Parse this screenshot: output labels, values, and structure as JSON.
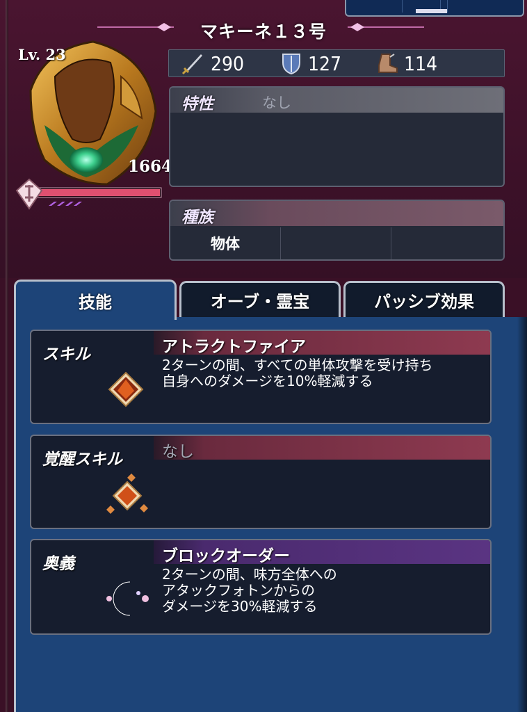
{
  "unit": {
    "name": "マキーネ１３号",
    "level": "Lv. 23",
    "power": "1664"
  },
  "stats": {
    "attack": "290",
    "defense": "127",
    "speed": "114"
  },
  "traits": {
    "label": "特性",
    "value": "なし"
  },
  "race": {
    "label": "種族",
    "cells": [
      "物体",
      "",
      ""
    ]
  },
  "tabs": [
    {
      "label": "技能",
      "active": true
    },
    {
      "label": "オーブ・霊宝",
      "active": false
    },
    {
      "label": "パッシブ効果",
      "active": false
    }
  ],
  "skills": [
    {
      "type": "スキル",
      "name": "アトラクトファイア",
      "lines": [
        "2ターンの間、すべての単体攻撃を受け持ち",
        "自身へのダメージを10%軽減する"
      ],
      "bar_color": "#8e3a50",
      "icon": "fire-crystal-icon"
    },
    {
      "type": "覚醒スキル",
      "name": "なし",
      "lines": [],
      "bar_color": "#8e3a50",
      "icon": "awakened-fire-crystal-icon"
    },
    {
      "type": "奥義",
      "name": "ブロックオーダー",
      "lines": [
        "2ターンの間、味方全体への",
        "アタックフォトンからの",
        "ダメージを30%軽減する"
      ],
      "bar_color": "#5a3482",
      "icon": "rainbow-orb-icon"
    }
  ],
  "colors": {
    "background": "#3a1026",
    "content_blue": "#1d4478",
    "hp_bar": "#e05070"
  }
}
